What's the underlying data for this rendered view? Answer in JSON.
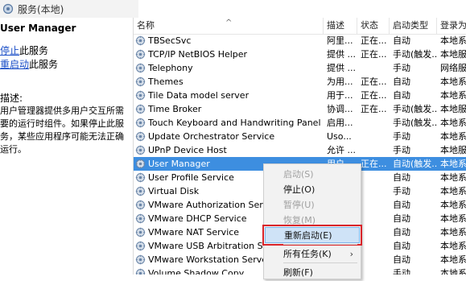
{
  "tab": {
    "title": "服务(本地)"
  },
  "left": {
    "service_title": "User Manager",
    "stop_link": "停止",
    "stop_suffix": "此服务",
    "restart_link": "重启动",
    "restart_suffix": "此服务",
    "desc_label": "描述:",
    "desc_text": "用户管理器提供多用户交互所需要的运行时组件。如果停止此服务，某些应用程序可能无法正确运行。"
  },
  "columns": {
    "name": "名称",
    "desc": "描述",
    "status": "状态",
    "startup": "启动类型",
    "logon": "登录为"
  },
  "rows": [
    {
      "name": "TBSecSvc",
      "desc": "阿里...",
      "status": "正在...",
      "startup": "自动",
      "logon": "本地系统"
    },
    {
      "name": "TCP/IP NetBIOS Helper",
      "desc": "提供 ...",
      "status": "正在...",
      "startup": "手动(触发...",
      "logon": "本地服务"
    },
    {
      "name": "Telephony",
      "desc": "提供 ...",
      "status": "",
      "startup": "手动",
      "logon": "网络服务"
    },
    {
      "name": "Themes",
      "desc": "为用...",
      "status": "正在...",
      "startup": "自动",
      "logon": "本地系统"
    },
    {
      "name": "Tile Data model server",
      "desc": "用于...",
      "status": "正在...",
      "startup": "自动",
      "logon": "本地系统"
    },
    {
      "name": "Time Broker",
      "desc": "协调...",
      "status": "正在...",
      "startup": "手动(触发...",
      "logon": "本地服务"
    },
    {
      "name": "Touch Keyboard and Handwriting Panel Servi...",
      "desc": "启用...",
      "status": "",
      "startup": "手动(触发...",
      "logon": "本地系统"
    },
    {
      "name": "Update Orchestrator Service",
      "desc": "Uso...",
      "status": "",
      "startup": "手动",
      "logon": "本地系统"
    },
    {
      "name": "UPnP Device Host",
      "desc": "允许 ...",
      "status": "",
      "startup": "手动",
      "logon": "本地服务"
    },
    {
      "name": "User Manager",
      "desc": "用户...",
      "status": "正在...",
      "startup": "自动(触发...",
      "logon": "本地系统"
    },
    {
      "name": "User Profile Service",
      "desc": "",
      "status": "",
      "startup": "自动",
      "logon": "本地系统"
    },
    {
      "name": "Virtual Disk",
      "desc": "",
      "status": "",
      "startup": "手动",
      "logon": "本地系统"
    },
    {
      "name": "VMware Authorization Service",
      "desc": "",
      "status": "",
      "startup": "自动",
      "logon": "本地系统"
    },
    {
      "name": "VMware DHCP Service",
      "desc": "",
      "status": "",
      "startup": "自动",
      "logon": "本地系统"
    },
    {
      "name": "VMware NAT Service",
      "desc": "",
      "status": "",
      "startup": "自动",
      "logon": "本地系统"
    },
    {
      "name": "VMware USB Arbitration Service",
      "desc": "",
      "status": "",
      "startup": "自动",
      "logon": "本地系统"
    },
    {
      "name": "VMware Workstation Server",
      "desc": "",
      "status": "",
      "startup": "自动",
      "logon": "本地系统"
    },
    {
      "name": "Volume Shadow Copy",
      "desc": "",
      "status": "",
      "startup": "手动",
      "logon": "本地系统"
    }
  ],
  "selected_row": 9,
  "context_menu": {
    "items": [
      {
        "label": "启动(S)",
        "disabled": true
      },
      {
        "label": "停止(O)",
        "disabled": false
      },
      {
        "label": "暂停(U)",
        "disabled": true
      },
      {
        "label": "恢复(M)",
        "disabled": true
      },
      {
        "label": "重新启动(E)",
        "disabled": false,
        "highlighted": true
      },
      {
        "label": "所有任务(K)",
        "disabled": false,
        "submenu": true
      },
      {
        "label": "刷新(F)",
        "disabled": false
      }
    ],
    "submenu_arrow": "›"
  },
  "colors": {
    "selection": "#3d8ee0",
    "link": "#1a4ec7",
    "highlight_border": "#d9242a"
  }
}
